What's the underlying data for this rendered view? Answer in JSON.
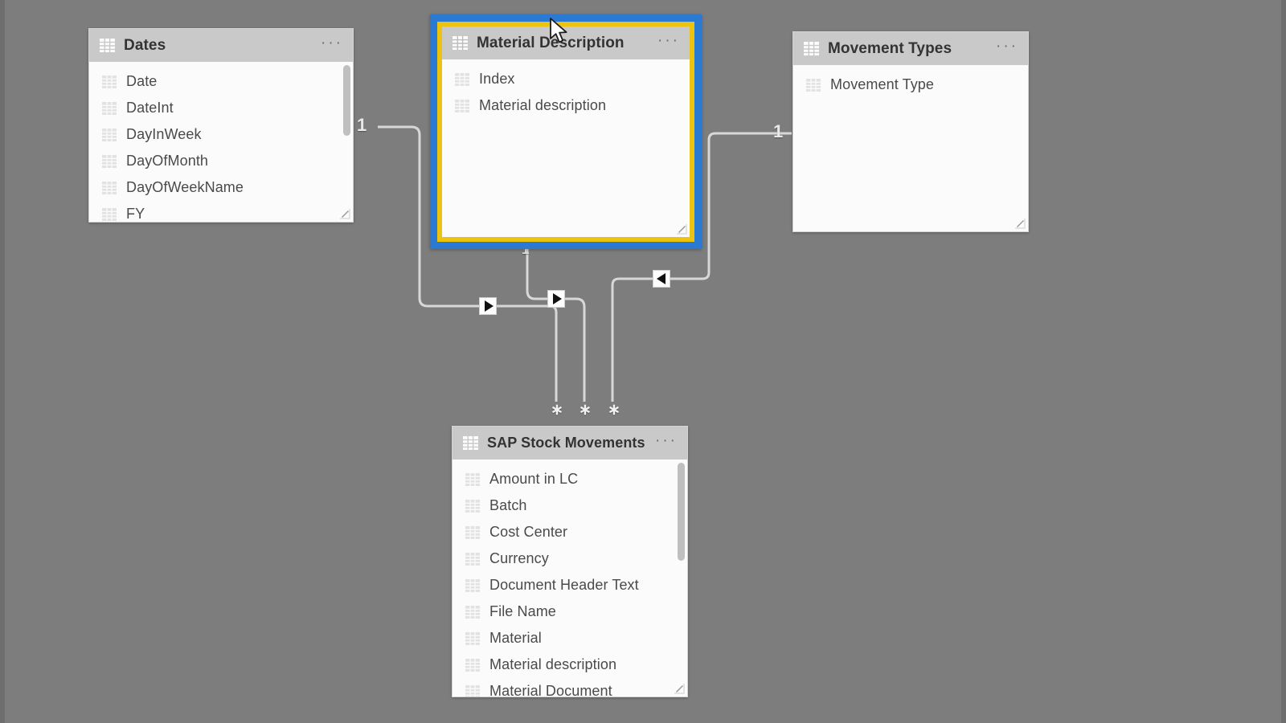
{
  "app": {
    "view_name": "model-view",
    "canvas_background": "#7d7d7d",
    "selection_outer_color": "#2a7ad4",
    "selection_inner_color": "#ecc40f",
    "header_color": "#c9c9c9",
    "relationship_line_color": "#d8d8d8"
  },
  "tables": [
    {
      "id": "dates",
      "title": "Dates",
      "menu": "···",
      "selected": false,
      "has_scrollbar": true,
      "fields": [
        {
          "name": "Date"
        },
        {
          "name": "DateInt"
        },
        {
          "name": "DayInWeek"
        },
        {
          "name": "DayOfMonth"
        },
        {
          "name": "DayOfWeekName"
        },
        {
          "name": "FY"
        }
      ]
    },
    {
      "id": "material-description",
      "title": "Material Description",
      "menu": "···",
      "selected": true,
      "has_scrollbar": false,
      "fields": [
        {
          "name": "Index"
        },
        {
          "name": "Material description"
        }
      ]
    },
    {
      "id": "movement-types",
      "title": "Movement Types",
      "menu": "···",
      "selected": false,
      "has_scrollbar": false,
      "fields": [
        {
          "name": "Movement Type"
        }
      ]
    },
    {
      "id": "sap-stock-movements",
      "title": "SAP Stock Movements",
      "menu": "···",
      "selected": false,
      "has_scrollbar": true,
      "fields": [
        {
          "name": "Amount in LC"
        },
        {
          "name": "Batch"
        },
        {
          "name": "Cost Center"
        },
        {
          "name": "Currency"
        },
        {
          "name": "Document Header Text"
        },
        {
          "name": "File Name"
        },
        {
          "name": "Material"
        },
        {
          "name": "Material description"
        },
        {
          "name": "Material Document"
        }
      ]
    }
  ],
  "relationships": [
    {
      "id": "dates-to-sap",
      "from_table": "Dates",
      "to_table": "SAP Stock Movements",
      "from_cardinality": "1",
      "to_cardinality": "*",
      "cross_filter_direction": "single"
    },
    {
      "id": "material-description-to-sap",
      "from_table": "Material Description",
      "to_table": "SAP Stock Movements",
      "from_cardinality": "1",
      "to_cardinality": "*",
      "cross_filter_direction": "single"
    },
    {
      "id": "movement-types-to-sap",
      "from_table": "Movement Types",
      "to_table": "SAP Stock Movements",
      "from_cardinality": "1",
      "to_cardinality": "*",
      "cross_filter_direction": "single"
    }
  ],
  "cardinality_markers": {
    "dates_one": "1",
    "material_description_one": "1",
    "movement_types_one": "1",
    "many_1": "∗",
    "many_2": "∗",
    "many_3": "∗"
  }
}
